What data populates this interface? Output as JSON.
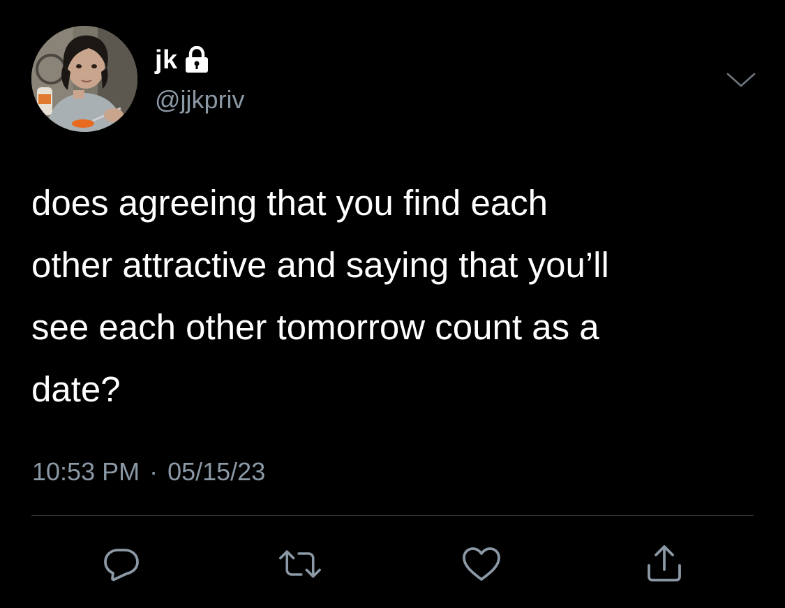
{
  "theme": {
    "background": "#000000",
    "text_primary": "#ffffff",
    "text_secondary": "#8b98a5",
    "divider": "#2f3336"
  },
  "author": {
    "display_name": "jk",
    "handle": "@jjkpriv",
    "protected_icon": "lock-icon",
    "avatar_icon": "avatar-photo"
  },
  "header": {
    "more_icon": "chevron-down-icon"
  },
  "tweet": {
    "text": "does agreeing that you find each\nother attractive and saying that you’ll\nsee each other tomorrow count as a\ndate?",
    "time": "10:53 PM",
    "separator": "·",
    "date": "05/15/23"
  },
  "actions": [
    {
      "name": "reply",
      "icon": "reply-icon"
    },
    {
      "name": "retweet",
      "icon": "retweet-icon"
    },
    {
      "name": "like",
      "icon": "heart-icon"
    },
    {
      "name": "share",
      "icon": "share-icon"
    }
  ]
}
